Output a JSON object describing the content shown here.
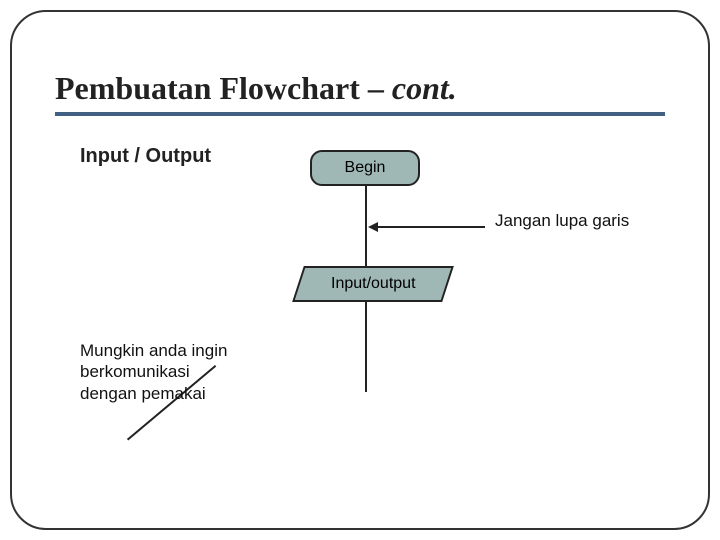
{
  "title": {
    "main": "Pembuatan Flowchart – ",
    "cont": "cont."
  },
  "subtitle": "Input / Output",
  "flow": {
    "begin": "Begin",
    "io": "Input/output"
  },
  "notes": {
    "right": "Jangan lupa garis",
    "left_l1": "Mungkin anda ingin",
    "left_l2": "berkomunikasi",
    "left_l3": "dengan pemakai"
  }
}
